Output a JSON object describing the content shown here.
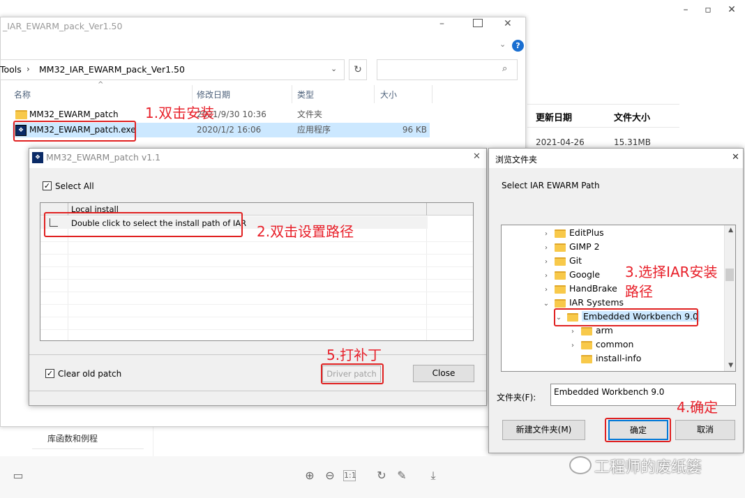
{
  "colors": {
    "annotation_red": "#e02020",
    "selection_blue": "#cce8ff",
    "help_blue": "#1a6fd1"
  },
  "explorer": {
    "title": "_IAR_EWARM_pack_Ver1.50",
    "address_parent": "Tools",
    "address_current": "MM32_IAR_EWARM_pack_Ver1.50",
    "columns": [
      "名称",
      "修改日期",
      "类型",
      "大小"
    ],
    "rows": [
      {
        "name": "MM32_EWARM_patch",
        "date": "2021/9/30 10:36",
        "type": "文件夹",
        "size": ""
      },
      {
        "name": "MM32_EWARM_patch.exe",
        "date": "2020/1/2 16:06",
        "type": "应用程序",
        "size": "96 KB"
      }
    ]
  },
  "background": {
    "col_date": "更新日期",
    "col_size": "文件大小",
    "row_date": "2021-04-26",
    "row_size": "15.31MB",
    "sidebar_item": "库函数和例程"
  },
  "patch_dialog": {
    "title": "MM32_EWARM_patch v1.1",
    "select_all": "Select All",
    "col_local_install": "Local install",
    "row_text": "Double click to select the install path of IAR",
    "clear_old_patch": "Clear old patch",
    "driver_patch": "Driver patch",
    "close": "Close"
  },
  "browse_dialog": {
    "title": "浏览文件夹",
    "prompt": "Select IAR EWARM Path",
    "tree": [
      {
        "label": "EditPlus",
        "level": 0,
        "chevron": "›"
      },
      {
        "label": "GIMP 2",
        "level": 0,
        "chevron": "›"
      },
      {
        "label": "Git",
        "level": 0,
        "chevron": "›"
      },
      {
        "label": "Google",
        "level": 0,
        "chevron": "›"
      },
      {
        "label": "HandBrake",
        "level": 0,
        "chevron": "›"
      },
      {
        "label": "IAR Systems",
        "level": 0,
        "chevron": "⌄"
      },
      {
        "label": "Embedded Workbench 9.0",
        "level": 1,
        "chevron": "⌄"
      },
      {
        "label": "arm",
        "level": 2,
        "chevron": "›"
      },
      {
        "label": "common",
        "level": 2,
        "chevron": "›"
      },
      {
        "label": "install-info",
        "level": 2,
        "chevron": ""
      }
    ],
    "folder_label": "文件夹(F):",
    "folder_value": "Embedded Workbench 9.0",
    "new_folder": "新建文件夹(M)",
    "ok": "确定",
    "cancel": "取消"
  },
  "annotations": {
    "step1": "1.双击安装",
    "step2": "2.双击设置路径",
    "step3_line1": "3.选择IAR安装",
    "step3_line2": "路径",
    "step4": "4.确定",
    "step5": "5.打补丁"
  },
  "watermark": "工程师的废纸篓",
  "icons": [
    "layout-icon",
    "zoom-in-icon",
    "zoom-out-icon",
    "fit-icon",
    "rotate-icon",
    "edit-icon",
    "download-icon"
  ]
}
